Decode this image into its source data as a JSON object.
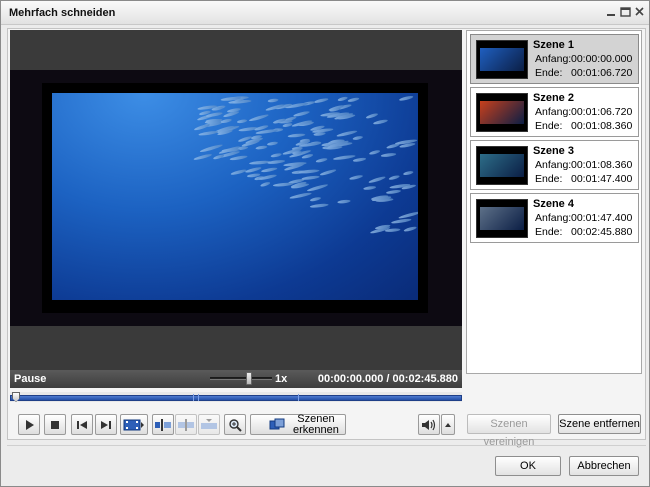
{
  "window": {
    "title": "Mehrfach schneiden"
  },
  "player": {
    "status": "Pause",
    "speed": "1x",
    "current_time": "00:00:00.000",
    "separator": "/",
    "total_time": "00:02:45.880",
    "timeline_markers": [
      "00:01:06.720",
      "00:01:08.360",
      "00:01:47.400"
    ]
  },
  "toolbar": {
    "icons": [
      "play-icon",
      "stop-icon",
      "previous-icon",
      "next-icon",
      "film-icon",
      "set-start-icon",
      "set-split-icon",
      "set-end-icon",
      "zoom-icon",
      "scene-detect-icon",
      "volume-icon",
      "volume-arrow-icon"
    ],
    "detect_scenes_line1": "Szenen",
    "detect_scenes_line2": "erkennen"
  },
  "scenes": [
    {
      "name": "Szene 1",
      "start_label": "Anfang:",
      "start": "00:00:00.000",
      "end_label": "Ende:",
      "end": "00:01:06.720",
      "selected": true,
      "thumb": "#1f5fc0"
    },
    {
      "name": "Szene 2",
      "start_label": "Anfang:",
      "start": "00:01:06.720",
      "end_label": "Ende:",
      "end": "00:01:08.360",
      "selected": false,
      "thumb": "#c8401c"
    },
    {
      "name": "Szene 3",
      "start_label": "Anfang:",
      "start": "00:01:08.360",
      "end_label": "Ende:",
      "end": "00:01:47.400",
      "selected": false,
      "thumb": "#2d6d88"
    },
    {
      "name": "Szene 4",
      "start_label": "Anfang:",
      "start": "00:01:47.400",
      "end_label": "Ende:",
      "end": "00:02:45.880",
      "selected": false,
      "thumb": "#5d7088"
    }
  ],
  "actions": {
    "merge_scenes": "Szenen vereinigen",
    "remove_scene": "Szene entfernen",
    "ok": "OK",
    "cancel": "Abbrechen"
  },
  "colors": {
    "accent": "#2450a8",
    "selection": "#d3d3d3"
  }
}
